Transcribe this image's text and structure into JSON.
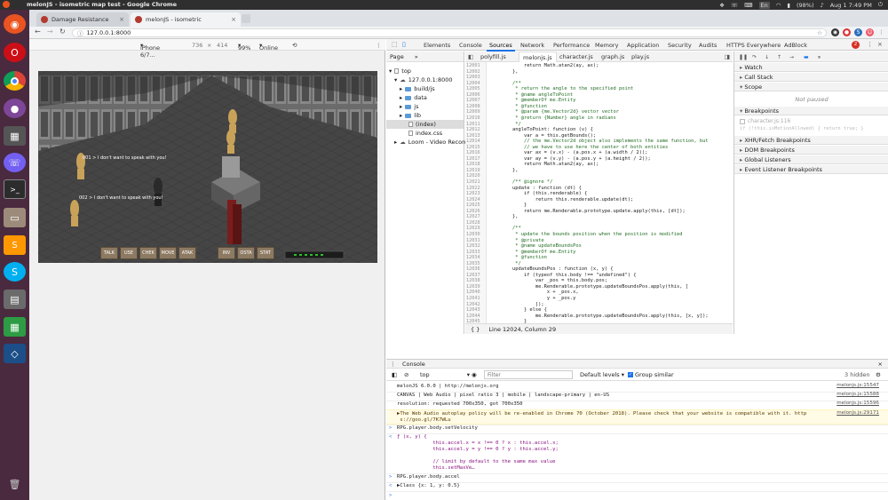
{
  "os": {
    "window_title": "melonJS - isometric map test - Google Chrome",
    "tray": {
      "battery": "(98%)",
      "lang": "En",
      "datetime": "Aug 1  7:49 PM"
    }
  },
  "browser": {
    "tabs": [
      {
        "label": "Damage Resistance",
        "close": "×"
      },
      {
        "label": "melonJS - isometric",
        "close": "×"
      }
    ],
    "url": "127.0.0.1:8000"
  },
  "device_toolbar": {
    "device": "iPhone 6/7...",
    "width": "736",
    "height": "414",
    "zoom": "99%",
    "network": "Online"
  },
  "game": {
    "speech": [
      "001 > I don't want to speak with you!",
      "002 > I don't want to speak with you!"
    ],
    "buttons": [
      "TALK",
      "USE",
      "CHEK",
      "MOVE",
      "ATAK",
      "INV",
      "OSTA",
      "STAT"
    ]
  },
  "devtools": {
    "tabs": [
      "Elements",
      "Console",
      "Sources",
      "Network",
      "Performance",
      "Memory",
      "Application",
      "Security",
      "Audits",
      "HTTPS Everywhere",
      "AdBlock"
    ],
    "active_tab": "Sources",
    "issues_count": "2",
    "navigator": {
      "tabs": [
        "Page",
        "»"
      ],
      "tree": [
        {
          "label": "top",
          "type": "frame",
          "indent": 0
        },
        {
          "label": "127.0.0.1:8000",
          "type": "cloud",
          "indent": 1
        },
        {
          "label": "build/js",
          "type": "folder",
          "indent": 2
        },
        {
          "label": "data",
          "type": "folder",
          "indent": 2
        },
        {
          "label": "js",
          "type": "folder",
          "indent": 2
        },
        {
          "label": "lib",
          "type": "folder",
          "indent": 2
        },
        {
          "label": "(index)",
          "type": "file",
          "indent": 2,
          "selected": true
        },
        {
          "label": "index.css",
          "type": "file",
          "indent": 2
        },
        {
          "label": "Loom - Video Recorde",
          "type": "cloud",
          "indent": 1
        }
      ]
    },
    "editor": {
      "file_tabs": [
        "polyfill.js",
        "melonjs.js",
        "character.js",
        "graph.js",
        "play.js"
      ],
      "active_file": "melonjs.js",
      "first_line": 12001,
      "lines": [
        "            return Math.atan2(ay, ax);",
        "        },",
        "",
        "        /**",
        "         * return the angle to the specified point",
        "         * @name angleToPoint",
        "         * @memberOf me.Entity",
        "         * @function",
        "         * @param {me.Vector2d} vector vector",
        "         * @return {Number} angle in radians",
        "         */",
        "        angleToPoint: function (v) {",
        "            var a = this.getBounds();",
        "            // the me.Vector2d object also implements the same function, but",
        "            // we have to use here the center of both entities",
        "            var ax = (v.x) - (a.pos.x + (a.width / 2));",
        "            var ay = (v.y) - (a.pos.y + (a.height / 2));",
        "            return Math.atan2(ay, ax);",
        "        },",
        "",
        "        /** @ignore */",
        "        update : function (dt) {",
        "            if (this.renderable) {",
        "                return this.renderable.update(dt);",
        "            }",
        "            return me.Renderable.prototype.update.apply(this, [dt]);",
        "        },",
        "",
        "        /**",
        "         * update the bounds position when the position is modified",
        "         * @private",
        "         * @name updateBoundsPos",
        "         * @memberOf me.Entity",
        "         * @function",
        "         */",
        "        updateBoundsPos : function (x, y) {",
        "            if (typeof this.body !== \"undefined\") {",
        "                var _pos = this.body.pos;",
        "                me.Renderable.prototype.updateBoundsPos.apply(this, [",
        "                    x + _pos.x,",
        "                    y + _pos.y",
        "                ]);",
        "            } else {",
        "                me.Renderable.prototype.updateBoundsPos.apply(this, [x, y]);",
        "            }"
      ],
      "status": "Line 12024, Column 29"
    },
    "debugger": {
      "sections": [
        {
          "label": "Watch",
          "open": false
        },
        {
          "label": "Call Stack",
          "open": false
        },
        {
          "label": "Scope",
          "open": true
        }
      ],
      "not_paused": "Not paused",
      "breakpoints_label": "Breakpoints",
      "breakpoint_file": "character.js:116",
      "breakpoint_code": "if (!this.isMotionAllowed) { return true; }",
      "more_sections": [
        "XHR/Fetch Breakpoints",
        "DOM Breakpoints",
        "Global Listeners",
        "Event Listener Breakpoints"
      ]
    },
    "console": {
      "drawer_label": "Console",
      "context": "top",
      "filter_placeholder": "Filter",
      "levels": "Default levels",
      "group_similar": "Group similar",
      "hidden": "3 hidden",
      "rows": [
        {
          "text": "melonJS 6.0.0 | http://melonjs.org",
          "src": "melonjs.js:15547",
          "kind": "log"
        },
        {
          "text": "CANVAS | Web Audio | pixel ratio 3 | mobile | landscape-primary | en-US",
          "src": "melonjs.js:15588",
          "kind": "log"
        },
        {
          "text": "resolution: requested 700x350, got 700x350",
          "src": "melonjs.js:15596",
          "kind": "log"
        },
        {
          "text": "▶The Web Audio autoplay policy will be re-enabled in Chrome 70 (October 2018). Please check that your website is compatible with it. http\n s://goo.gl/7K7WLu",
          "src": "melonjs.js:29171",
          "kind": "warn"
        },
        {
          "text": "RPG.player.body.setVelocity",
          "src": "",
          "kind": "input"
        },
        {
          "text": "ƒ (x, y) {\n            this.accel.x = x !== 0 ? x : this.accel.x;\n            this.accel.y = y !== 0 ? y : this.accel.y;\n\n            // limit by default to the same max value\n            this.setMaxVe…",
          "src": "",
          "kind": "output"
        },
        {
          "text": "RPG.player.body.accel",
          "src": "",
          "kind": "input"
        },
        {
          "text": "▶Class {x: 1, y: 0.5}",
          "src": "",
          "kind": "output"
        }
      ]
    }
  }
}
